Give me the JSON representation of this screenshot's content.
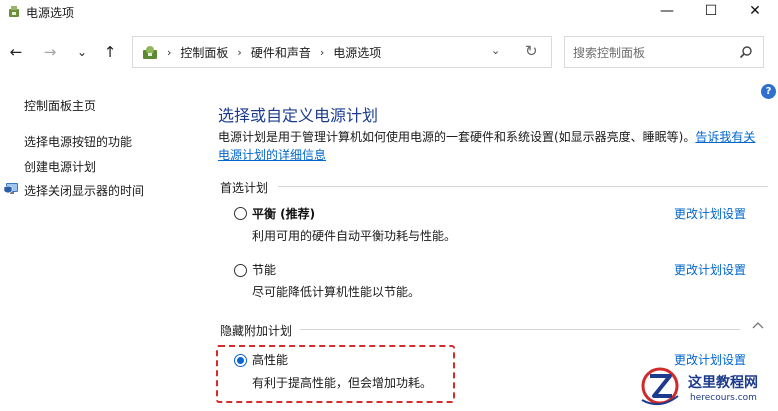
{
  "window": {
    "title": "电源选项",
    "minimize_glyph": "—",
    "maximize_glyph": "☐",
    "close_glyph": "✕"
  },
  "nav": {
    "back_glyph": "←",
    "forward_glyph": "→",
    "recent_glyph": "⌄",
    "up_glyph": "↑",
    "breadcrumbs": [
      "控制面板",
      "硬件和声音",
      "电源选项"
    ],
    "separator": "›",
    "dropdown_glyph": "⌄",
    "refresh_glyph": "↻",
    "search_placeholder": "搜索控制面板"
  },
  "help": {
    "glyph": "?"
  },
  "sidebar": {
    "items": [
      {
        "label": "控制面板主页"
      },
      {
        "label": "选择电源按钮的功能"
      },
      {
        "label": "创建电源计划"
      },
      {
        "label": "选择关闭显示器的时间"
      }
    ]
  },
  "main": {
    "title": "选择或自定义电源计划",
    "description": "电源计划是用于管理计算机如何使用电源的一套硬件和系统设置(如显示器亮度、睡眠等)。",
    "description_link": "告诉我有关电源计划的详细信息",
    "preferred_section": "首选计划",
    "hidden_section": "隐藏附加计划",
    "change_link_label": "更改计划设置",
    "plans": [
      {
        "name": "平衡 (推荐)",
        "description": "利用可用的硬件自动平衡功耗与性能。",
        "selected": false
      },
      {
        "name": "节能",
        "description": "尽可能降低计算机性能以节能。",
        "selected": false
      },
      {
        "name": "高性能",
        "description": "有利于提高性能，但会增加功耗。",
        "selected": true
      }
    ]
  },
  "watermark": {
    "title": "这里教程网",
    "url": "herecours.com"
  },
  "colors": {
    "link": "#0066cc",
    "title": "#1c3d8f",
    "radio_selected": "#0a64d3",
    "highlight_border": "#d62b2b"
  }
}
